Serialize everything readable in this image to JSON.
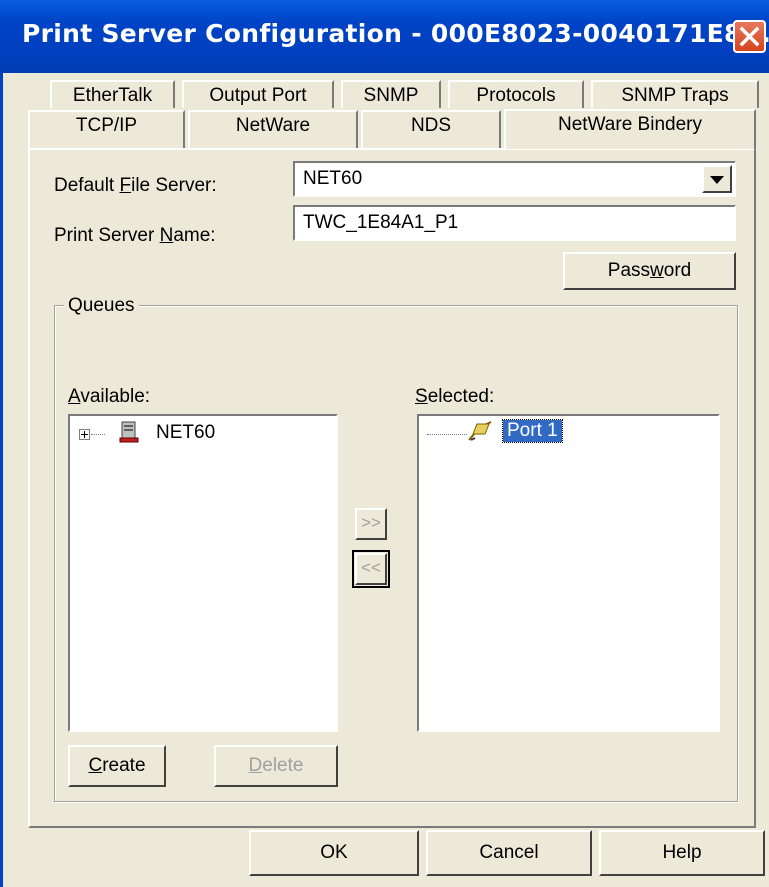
{
  "window": {
    "title": "Print Server Configuration - 000E8023-0040171E8...",
    "close_icon": "close-icon"
  },
  "tabs": {
    "row1": [
      "EtherTalk",
      "Output Port",
      "SNMP",
      "Protocols",
      "SNMP Traps"
    ],
    "row2": [
      "TCP/IP",
      "NetWare",
      "NDS",
      "NetWare Bindery"
    ],
    "active": "NetWare Bindery"
  },
  "form": {
    "default_file_server": {
      "label_pre": "Default ",
      "label_ul": "F",
      "label_post": "ile Server:",
      "value": "NET60"
    },
    "print_server_name": {
      "label_pre": "Print Server ",
      "label_ul": "N",
      "label_post": "ame:",
      "value": "TWC_1E84A1_P1"
    },
    "password_button": {
      "pre": "Pass",
      "ul": "w",
      "post": "ord"
    }
  },
  "queues": {
    "group_label": "Queues",
    "available": {
      "label_ul": "A",
      "label_post": "vailable:",
      "items": [
        "NET60"
      ],
      "expand_glyph": "+"
    },
    "selected": {
      "label_ul": "S",
      "label_post": "elected:",
      "items": [
        "Port 1"
      ]
    },
    "add_button": ">>",
    "remove_button": "<<",
    "create_button": {
      "ul": "C",
      "post": "reate"
    },
    "delete_button": {
      "ul": "D",
      "post": "elete"
    }
  },
  "dialog_buttons": {
    "ok": "OK",
    "cancel": "Cancel",
    "help": "Help"
  },
  "colors": {
    "title_bar": "#0043c6",
    "selection": "#316ac5",
    "face": "#ece9d8"
  }
}
